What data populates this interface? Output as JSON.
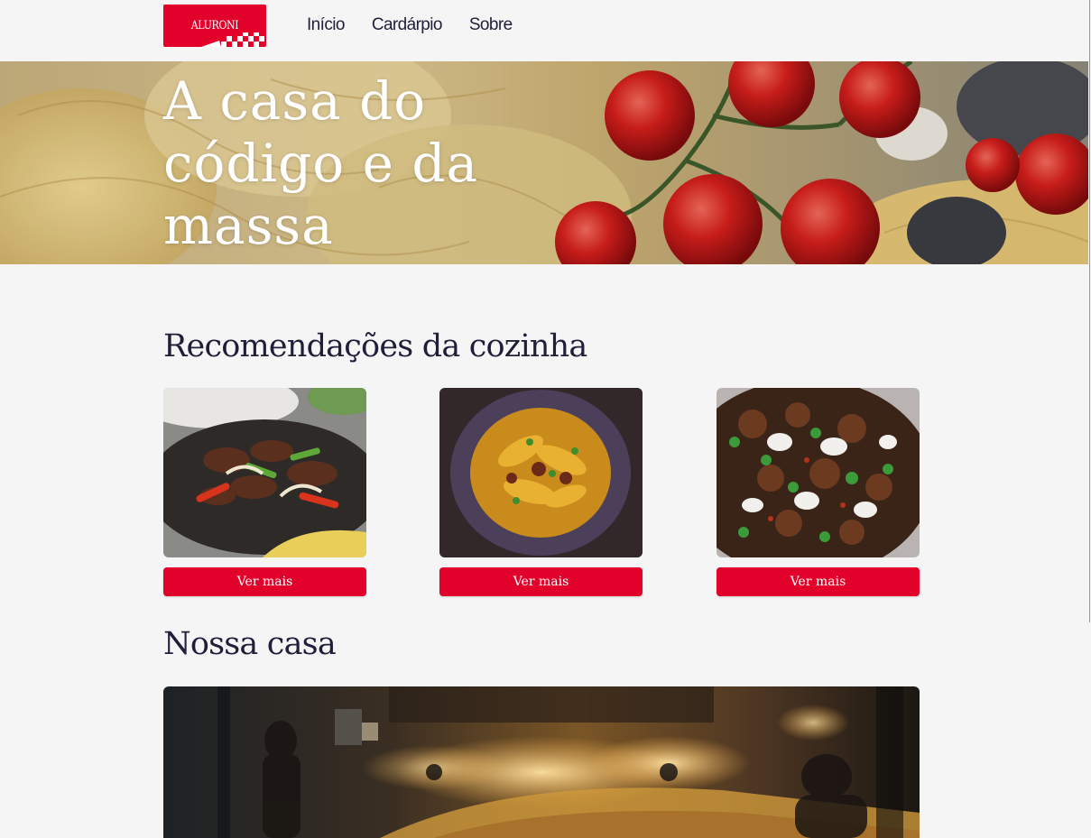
{
  "brand": {
    "name": "ALURONI",
    "color": "#e1012b"
  },
  "nav": {
    "items": [
      {
        "label": "Início"
      },
      {
        "label": "Cardárpio"
      },
      {
        "label": "Sobre"
      }
    ]
  },
  "hero": {
    "title": "A casa do código e da massa"
  },
  "recommendations": {
    "title": "Recomendações da cozinha",
    "cards": [
      {
        "button_label": "Ver mais"
      },
      {
        "button_label": "Ver mais"
      },
      {
        "button_label": "Ver mais"
      }
    ]
  },
  "house": {
    "title": "Nossa casa"
  },
  "colors": {
    "accent": "#e1012b",
    "text": "#1f1f3a",
    "background": "#f5f5f5"
  }
}
